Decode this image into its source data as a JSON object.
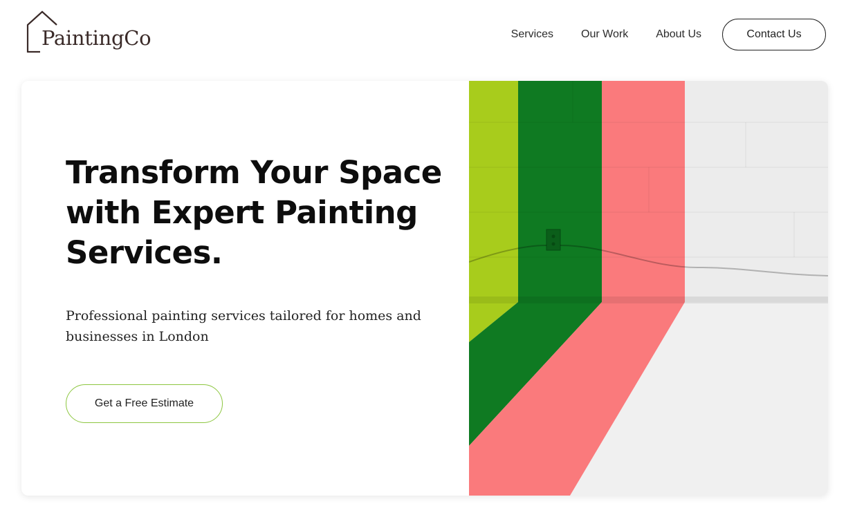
{
  "brand": {
    "name": "PaintingCo",
    "logo_icon": "house-outline-icon",
    "text_color": "#3a2a28"
  },
  "nav": {
    "items": [
      {
        "label": "Services"
      },
      {
        "label": "Our Work"
      },
      {
        "label": "About Us"
      }
    ],
    "contact_label": "Contact Us"
  },
  "hero": {
    "title": "Transform Your Space with Expert Painting Services.",
    "subtitle": "Professional painting services tailored for homes and businesses in London",
    "cta_label": "Get a Free Estimate",
    "cta_border_color": "#8cc63f",
    "image": {
      "subject": "painted-wall-corner-stripes",
      "colors": [
        "#a8cc1c",
        "#0f7a22",
        "#fa7a7c",
        "#ececec"
      ]
    }
  }
}
